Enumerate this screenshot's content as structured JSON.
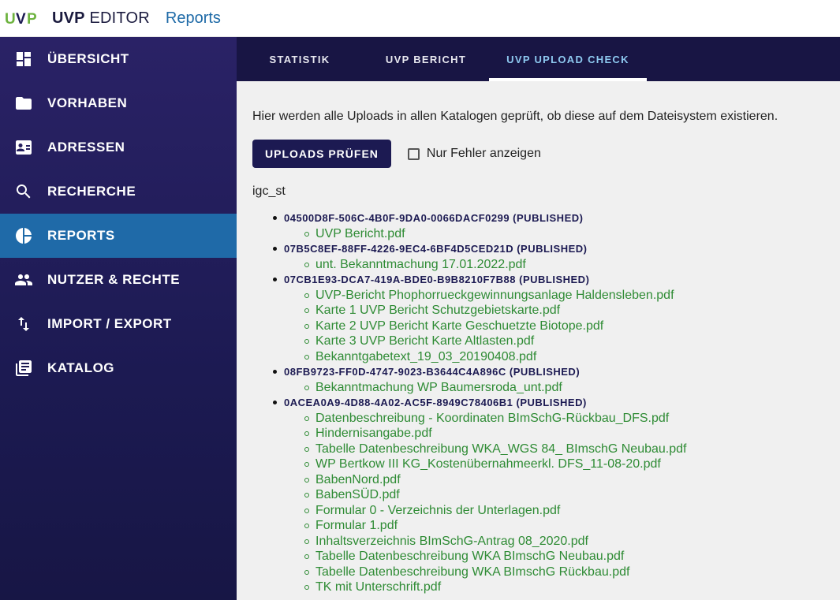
{
  "header": {
    "logo_text": "UVP",
    "app_name_bold": "UVP",
    "app_name_rest": " EDITOR",
    "breadcrumb": "Reports"
  },
  "sidebar": {
    "items": [
      {
        "label": "ÜBERSICHT",
        "icon": "dashboard-icon",
        "active": false
      },
      {
        "label": "VORHABEN",
        "icon": "folder-icon",
        "active": false
      },
      {
        "label": "ADRESSEN",
        "icon": "contact-card-icon",
        "active": false
      },
      {
        "label": "RECHERCHE",
        "icon": "search-icon",
        "active": false
      },
      {
        "label": "REPORTS",
        "icon": "pie-chart-icon",
        "active": true
      },
      {
        "label": "NUTZER & RECHTE",
        "icon": "people-icon",
        "active": false
      },
      {
        "label": "IMPORT / EXPORT",
        "icon": "import-export-icon",
        "active": false
      },
      {
        "label": "KATALOG",
        "icon": "library-books-icon",
        "active": false
      }
    ]
  },
  "tabs": [
    {
      "label": "STATISTIK",
      "active": false
    },
    {
      "label": "UVP BERICHT",
      "active": false
    },
    {
      "label": "UVP UPLOAD CHECK",
      "active": true
    }
  ],
  "main": {
    "description": "Hier werden alle Uploads in allen Katalogen geprüft, ob diese auf dem Dateisystem existieren.",
    "check_button": "UPLOADS PRÜFEN",
    "only_errors_label": "Nur Fehler anzeigen",
    "only_errors_checked": false,
    "catalog": "igc_st",
    "groups": [
      {
        "id": "04500D8F-506C-4B0F-9DA0-0066DACF0299 (PUBLISHED)",
        "files": [
          "UVP Bericht.pdf"
        ]
      },
      {
        "id": "07B5C8EF-88FF-4226-9EC4-6BF4D5CED21D (PUBLISHED)",
        "files": [
          "unt. Bekanntmachung 17.01.2022.pdf"
        ]
      },
      {
        "id": "07CB1E93-DCA7-419A-BDE0-B9B8210F7B88 (PUBLISHED)",
        "files": [
          "UVP-Bericht Phophorrueckgewinnungsanlage Haldensleben.pdf",
          "Karte 1 UVP Bericht Schutzgebietskarte.pdf",
          "Karte 2 UVP Bericht Karte Geschuetzte Biotope.pdf",
          "Karte 3 UVP Bericht Karte Altlasten.pdf",
          "Bekanntgabetext_19_03_20190408.pdf"
        ]
      },
      {
        "id": "08FB9723-FF0D-4747-9023-B3644C4A896C (PUBLISHED)",
        "files": [
          "Bekanntmachung WP Baumersroda_unt.pdf"
        ]
      },
      {
        "id": "0ACEA0A9-4D88-4A02-AC5F-8949C78406B1 (PUBLISHED)",
        "files": [
          "Datenbeschreibung - Koordinaten BImSchG-Rückbau_DFS.pdf",
          "Hindernisangabe.pdf",
          "Tabelle Datenbeschreibung WKA_WGS 84_ BImschG Neubau.pdf",
          "WP Bertkow III KG_Kostenübernahmeerkl. DFS_11-08-20.pdf",
          "BabenNord.pdf",
          "BabenSÜD.pdf",
          "Formular 0 - Verzeichnis der Unterlagen.pdf",
          "Formular 1.pdf",
          "Inhaltsverzeichnis BImSchG-Antrag 08_2020.pdf",
          "Tabelle Datenbeschreibung WKA BImschG Neubau.pdf",
          "Tabelle Datenbeschreibung WKA BImschG Rückbau.pdf",
          "TK mit Unterschrift.pdf"
        ]
      }
    ]
  },
  "colors": {
    "sidebar_bg": "#1c1a52",
    "active_item": "#1f6aa8",
    "link_green": "#2e8b34",
    "active_tab_text": "#8ec9f0",
    "breadcrumb": "#1e6aa7"
  }
}
